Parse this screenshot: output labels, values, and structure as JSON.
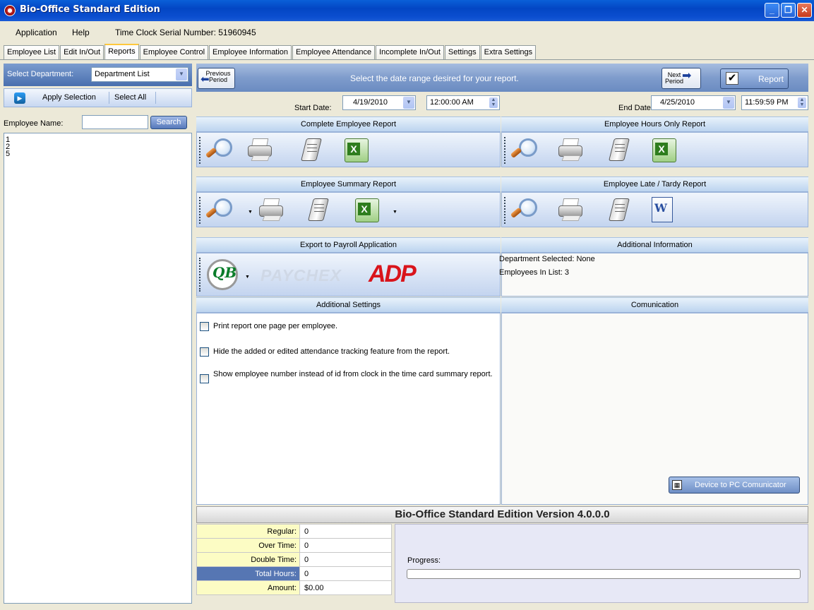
{
  "window": {
    "title": "Bio-Office Standard Edition"
  },
  "menu": {
    "items": [
      "Application",
      "Help"
    ],
    "serial_label": "Time Clock Serial Number: 51960945"
  },
  "tabs": [
    "Employee List",
    "Edit In/Out",
    "Reports",
    "Employee Control",
    "Employee Information",
    "Employee Attendance",
    "Incomplete In/Out",
    "Settings",
    "Extra Settings"
  ],
  "active_tab": "Reports",
  "left": {
    "select_dept_label": "Select Department:",
    "dept_value": "Department List",
    "apply_label": "Apply Selection",
    "select_all_label": "Select All",
    "emp_name_label": "Employee Name:",
    "emp_name_value": "",
    "search_label": "Search",
    "employees": [
      "1",
      "2",
      "5"
    ]
  },
  "topbar": {
    "prev_label": "Previous Period",
    "message": "Select the date range desired for your report.",
    "next_label": "Next Period",
    "report_label": "Report"
  },
  "dates": {
    "start_label": "Start Date:",
    "start_date": "4/19/2010",
    "start_time": "12:00:00 AM",
    "end_label": "End Date:",
    "end_date": "4/25/2010",
    "end_time": "11:59:59 PM"
  },
  "sections": {
    "complete": "Complete Employee Report",
    "hours": "Employee Hours Only Report",
    "summary": "Employee Summary Report",
    "late": "Employee Late / Tardy Report",
    "payroll": "Export to Payroll Application",
    "addinfo": "Additional Information",
    "addsettings": "Additional Settings",
    "comm": "Comunication"
  },
  "icons": {
    "preview": "magnifier-icon",
    "print": "printer-icon",
    "document": "document-icon",
    "excel": "excel-icon",
    "word": "word-icon"
  },
  "payroll": {
    "qb": "QB",
    "paychex": "PAYCHEX",
    "adp": "ADP"
  },
  "additional_info": {
    "dept_selected": "Department Selected: None",
    "employees_in_list": "Employees In List: 3"
  },
  "settings": [
    {
      "label": "Print report one page per employee.",
      "checked": false
    },
    {
      "label": "Hide the added or edited attendance tracking feature from the report.",
      "checked": false
    },
    {
      "label": "Show employee number instead of id from clock in the time card summary report.",
      "checked": false
    }
  ],
  "comm_button": "Device to PC Comunicator",
  "version": "Bio-Office Standard Edition Version 4.0.0.0",
  "totals": [
    {
      "label": "Regular:",
      "value": "0"
    },
    {
      "label": "Over Time:",
      "value": "0"
    },
    {
      "label": "Double Time:",
      "value": "0"
    },
    {
      "label": "Total Hours:",
      "value": "0"
    },
    {
      "label": "Amount:",
      "value": "$0.00"
    }
  ],
  "progress": {
    "label": "Progress:",
    "value": 0
  }
}
